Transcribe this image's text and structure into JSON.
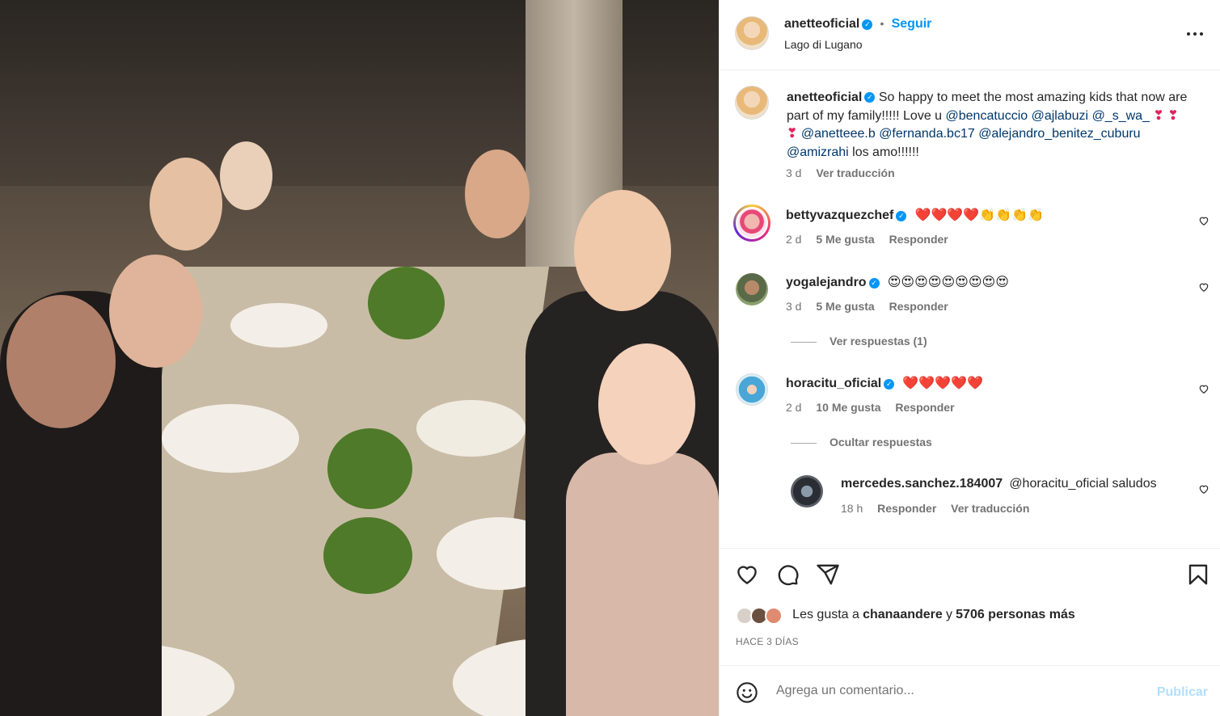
{
  "post": {
    "username": "anetteoficial",
    "follow_label": "Seguir",
    "separator": "•",
    "location": "Lago di Lugano",
    "more_label": "•••",
    "image_alt": "Group dinner photo at restaurant"
  },
  "caption": {
    "username": "anetteoficial",
    "text_before": "So happy to meet the most amazing kids that now are part of my family!!!!! Love u ",
    "mentions": [
      "@bencatuccio",
      "@ajlabuzi",
      "@_s_wa_",
      "@anetteee.b",
      "@fernanda.bc17",
      "@alejandro_benitez_cuburu",
      "@amizrahi"
    ],
    "hearts": "❣ ❣ ❣",
    "text_after": "los amo!!!!!!",
    "time": "3 d",
    "translate": "Ver traducción"
  },
  "comments": [
    {
      "username": "bettyvazquezchef",
      "text": "❤️❤️❤️❤️👏👏👏👏",
      "time": "2 d",
      "likes": "5 Me gusta",
      "reply": "Responder"
    },
    {
      "username": "yogalejandro",
      "text": "😍😍😍😍😍😍😍😍😍",
      "time": "3 d",
      "likes": "5 Me gusta",
      "reply": "Responder",
      "view_replies": "Ver respuestas (1)"
    },
    {
      "username": "horacitu_oficial",
      "text": "❤️❤️❤️❤️❤️",
      "time": "2 d",
      "likes": "10 Me gusta",
      "reply": "Responder",
      "hide_replies": "Ocultar respuestas",
      "replies": [
        {
          "username": "mercedes.sanchez.184007",
          "mention": "@horacitu_oficial",
          "text": "saludos",
          "time": "18 h",
          "reply": "Responder",
          "translate": "Ver traducción"
        }
      ]
    }
  ],
  "likes": {
    "prefix": "Les gusta a",
    "user": "chanaandere",
    "connector": "y",
    "others": "5706 personas más"
  },
  "date": "HACE 3 DÍAS",
  "comment_box": {
    "placeholder": "Agrega un comentario...",
    "publish": "Publicar"
  },
  "colors": {
    "accent": "#0095f6",
    "mention": "#00376b",
    "muted": "#737373",
    "publish_disabled": "#b2dffc"
  },
  "icons": [
    "heart-icon",
    "comment-icon",
    "share-icon",
    "bookmark-icon",
    "emoji-icon",
    "more-icon",
    "verified-icon"
  ]
}
